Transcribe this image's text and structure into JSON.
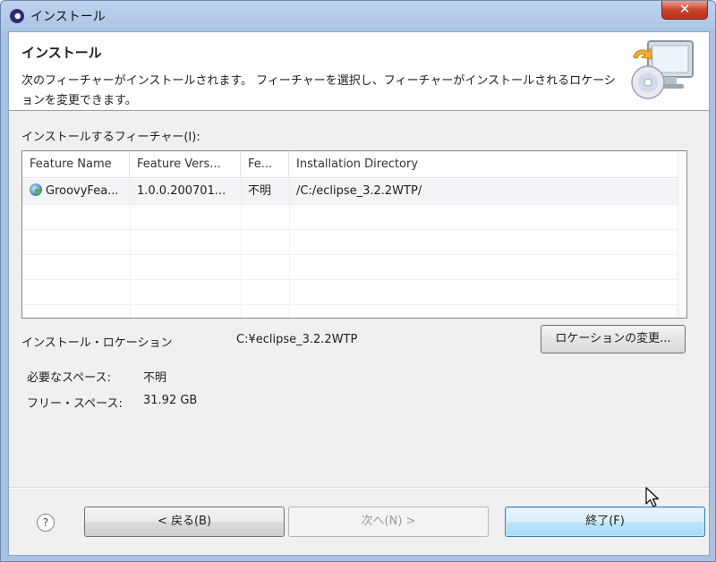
{
  "window": {
    "title": "インストール",
    "close_glyph": "✕"
  },
  "banner": {
    "title": "インストール",
    "description": "次のフィーチャーがインストールされます。 フィーチャーを選択し、フィーチャーがインストールされるロケーションを変更できます。",
    "icon": "install-disc-monitor-icon"
  },
  "features": {
    "label": "インストールするフィーチャー(I):",
    "columns": [
      "Feature Name",
      "Feature Vers...",
      "Fe...",
      "Installation Directory"
    ],
    "rows": [
      {
        "icon": "feature-icon",
        "name": "GroovyFea...",
        "version": "1.0.0.200701...",
        "fe": "不明",
        "directory": "/C:/eclipse_3.2.2WTP/"
      }
    ]
  },
  "location": {
    "label": "インストール・ロケーション",
    "value": "C:¥eclipse_3.2.2WTP",
    "change_button": "ロケーションの変更..."
  },
  "space": {
    "required_label": "必要なスペース:",
    "required_value": "不明",
    "free_label": "フリー・スペース:",
    "free_value": "31.92 GB"
  },
  "footer": {
    "help_glyph": "?",
    "back_button": "< 戻る(B)",
    "next_button": "次へ(N) >",
    "finish_button": "終了(F)"
  },
  "colors": {
    "title_bar": "#a9c2e3",
    "close_button": "#c8452e",
    "default_button": "#bee6fd"
  }
}
